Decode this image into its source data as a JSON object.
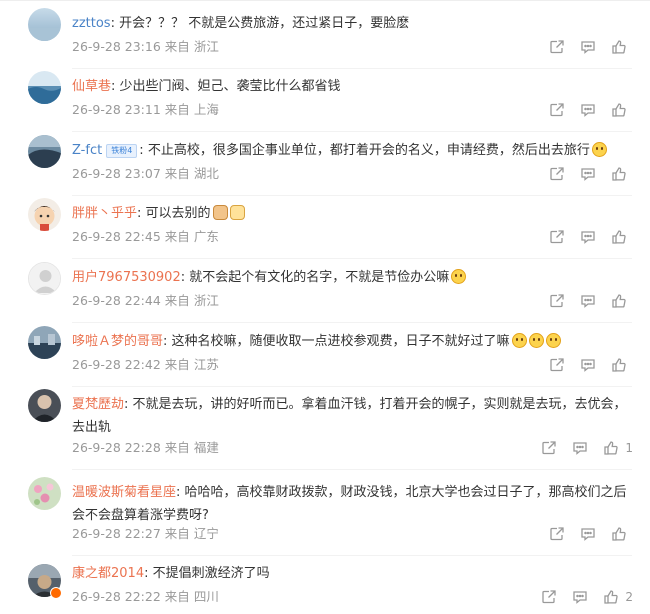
{
  "comments": [
    {
      "user": "zzttos",
      "sep": ":",
      "text": " 开会？？？ 不就是公费旅游，还过紧日子，要脸麽",
      "date": "26-9-28 23:16",
      "from": "来自",
      "location": "浙江",
      "likes": ""
    },
    {
      "user": "仙草巷",
      "sep": ":",
      "text": " 少出些门阀、妲己、袭莹比什么都省钱",
      "date": "26-9-28 23:11",
      "from": "来自",
      "location": "上海",
      "likes": ""
    },
    {
      "user": "Z-fct",
      "badge": "铁粉4",
      "sep": ":",
      "text": " 不止高校，很多国企事业单位，都打着开会的名义，申请经费，然后出去旅行",
      "emoji": "laugh-cry-emoji",
      "date": "26-9-28 23:07",
      "from": "来自",
      "location": "湖北",
      "likes": ""
    },
    {
      "user": "胖胖丶乎乎",
      "sep": ":",
      "text": " 可以去别的",
      "emoji": "dog-cat-emoji",
      "date": "26-9-28 22:45",
      "from": "来自",
      "location": "广东",
      "likes": ""
    },
    {
      "user": "用户7967530902",
      "sep": ":",
      "text": " 就不会起个有文化的名字，不就是节俭办公嘛",
      "emoji": "laugh-cry-emoji",
      "date": "26-9-28 22:44",
      "from": "来自",
      "location": "浙江",
      "likes": ""
    },
    {
      "user": "哆啦Ａ梦的哥哥",
      "sep": ":",
      "text": " 这种名校嘛，随便收取一点进校参观费，日子不就好过了嘛",
      "emoji": "drool-emoji-x3",
      "date": "26-9-28 22:42",
      "from": "来自",
      "location": "江苏",
      "likes": ""
    },
    {
      "user": "夏梵歷劫",
      "sep": ":",
      "text": " 不就是去玩，讲的好听而已。拿着血汗钱，打着开会的幌子，实则就是去玩，去优会，去出轨",
      "date": "26-9-28 22:28",
      "from": "来自",
      "location": "福建",
      "likes": "1"
    },
    {
      "user": "温暖波斯菊看星座",
      "sep": ":",
      "text": " 哈哈哈，高校靠财政拨款，财政没钱，北京大学也会过日子了，那高校们之后会不会盘算着涨学费呀?",
      "date": "26-9-28 22:27",
      "from": "来自",
      "location": "辽宁",
      "likes": ""
    },
    {
      "user": "康之都2014",
      "sep": ":",
      "text": " 不提倡刺激经济了吗",
      "date": "26-9-28 22:22",
      "from": "来自",
      "location": "四川",
      "likes": "2"
    }
  ],
  "colors": {
    "username": "#eb7350",
    "meta": "#999999",
    "text": "#333333"
  }
}
